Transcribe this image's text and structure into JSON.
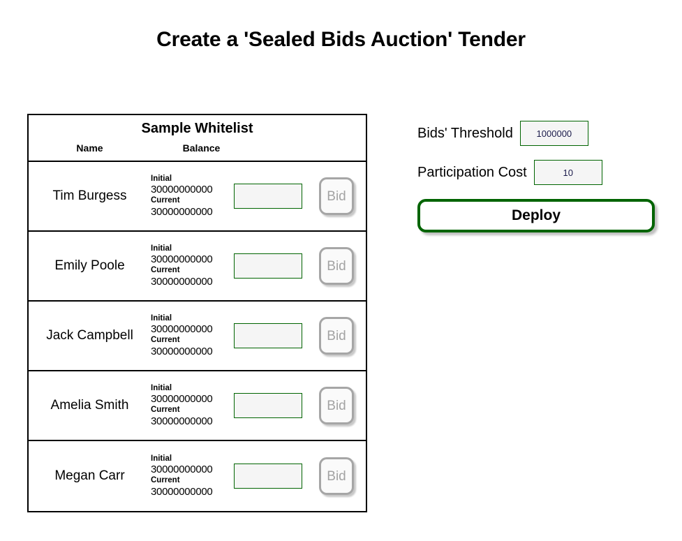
{
  "page": {
    "title": "Create a 'Sealed Bids Auction' Tender"
  },
  "whitelist": {
    "title": "Sample Whitelist",
    "columns": {
      "name": "Name",
      "balance": "Balance"
    },
    "labels": {
      "initial": "Initial",
      "current": "Current"
    },
    "bid_button_label": "Bid",
    "bid_input_value": "",
    "bid_input_placeholder": "",
    "rows": [
      {
        "name": "Tim Burgess",
        "initial": "30000000000",
        "current": "30000000000",
        "bid_value": ""
      },
      {
        "name": "Emily Poole",
        "initial": "30000000000",
        "current": "30000000000",
        "bid_value": ""
      },
      {
        "name": "Jack Campbell",
        "initial": "30000000000",
        "current": "30000000000",
        "bid_value": ""
      },
      {
        "name": "Amelia Smith",
        "initial": "30000000000",
        "current": "30000000000",
        "bid_value": ""
      },
      {
        "name": "Megan Carr",
        "initial": "30000000000",
        "current": "30000000000",
        "bid_value": ""
      }
    ]
  },
  "params": {
    "threshold_label": "Bids' Threshold",
    "threshold_value": "1000000",
    "cost_label": "Participation Cost",
    "cost_value": "10",
    "deploy_label": "Deploy"
  },
  "colors": {
    "accent_green": "#006400",
    "border_black": "#000000",
    "input_bg": "#f5f5f5",
    "disabled_gray": "#a3a3a3",
    "button_border_gray": "#a6a6a6",
    "page_bg": "#ffffff"
  }
}
